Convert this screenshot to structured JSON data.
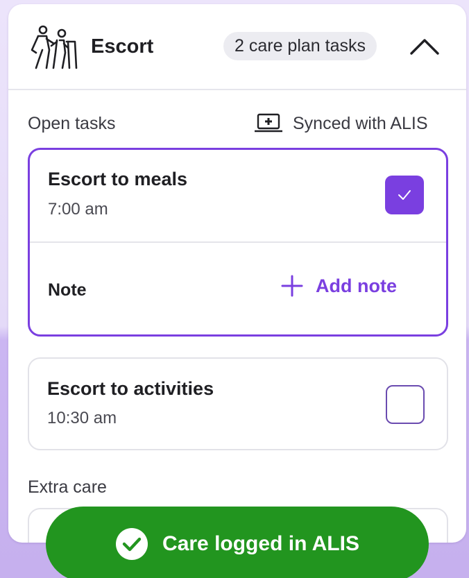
{
  "header": {
    "icon": "person-with-walker-icon",
    "title": "Escort",
    "task_count_badge": "2 care plan tasks",
    "collapse_icon": "chevron-up-icon"
  },
  "open_tasks": {
    "label": "Open tasks",
    "sync_status": {
      "icon": "laptop-plus-icon",
      "text": "Synced with ALIS"
    },
    "tasks": [
      {
        "title": "Escort to meals",
        "time": "7:00 am",
        "checked": true,
        "note_label": "Note",
        "add_note_label": "Add note"
      },
      {
        "title": "Escort to activities",
        "time": "10:30 am",
        "checked": false
      }
    ]
  },
  "extra_care": {
    "label": "Extra care"
  },
  "toast": {
    "icon": "check-circle-icon",
    "text": "Care logged in ALIS"
  },
  "colors": {
    "accent": "#7a3fe0",
    "success": "#22951f",
    "badge_bg": "#ececf1"
  }
}
